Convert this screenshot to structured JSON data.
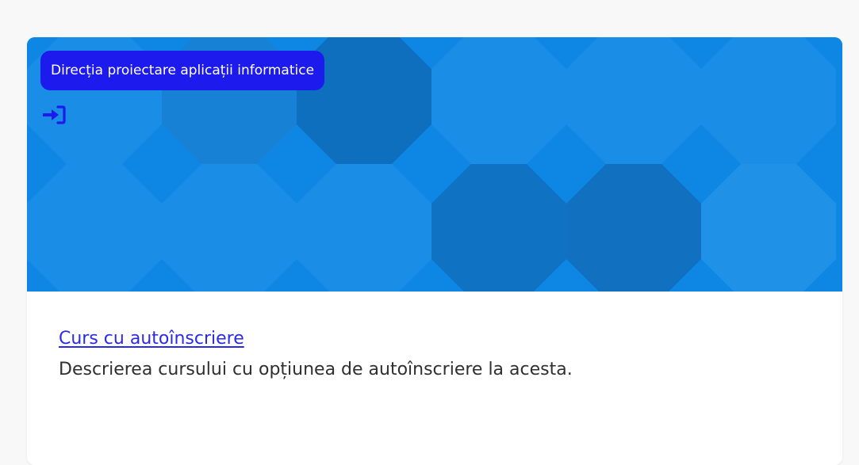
{
  "course_card": {
    "category": "Direcția proiectare aplicații informatice",
    "enrol_icon": "sign-in-icon",
    "title": "Curs cu autoînscriere",
    "description": "Descrierea cursului cu opțiunea de autoînscriere la acesta."
  },
  "colors": {
    "image_background": "#0e86e3",
    "badge_background": "#1d1aee",
    "icon": "#1d1aee",
    "link": "#2a2ae8",
    "text": "#2f2f2f"
  }
}
